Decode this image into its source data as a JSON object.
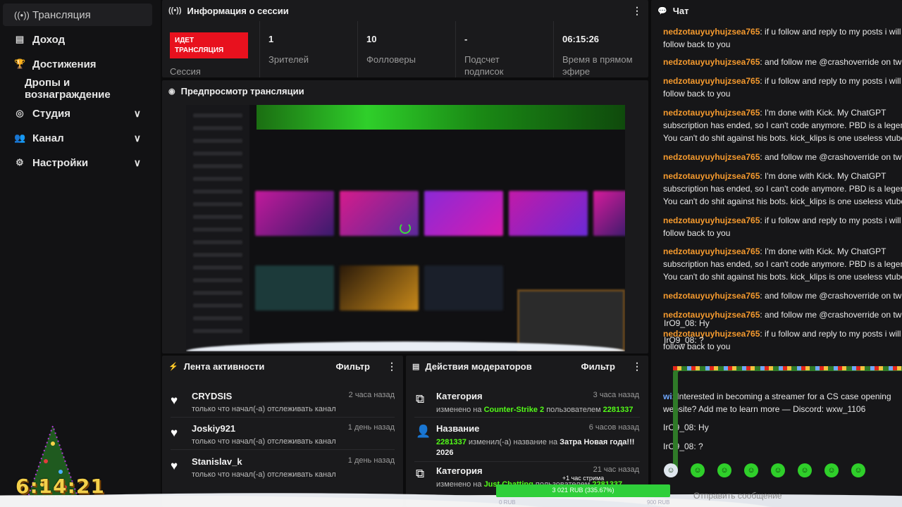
{
  "sidebar": {
    "items": [
      {
        "label": "Трансляция",
        "icon": "broadcast-icon"
      },
      {
        "label": "Доход",
        "icon": "wallet-icon"
      },
      {
        "label": "Достижения",
        "icon": "trophy-icon"
      },
      {
        "label": "Дропы и вознаграждение",
        "icon": ""
      },
      {
        "label": "Студия",
        "icon": "studio-icon"
      },
      {
        "label": "Канал",
        "icon": "users-icon"
      },
      {
        "label": "Настройки",
        "icon": "gear-icon"
      }
    ],
    "clock": "6:14:21"
  },
  "session": {
    "title": "Информация о сессии",
    "live_badge": "ИДЕТ ТРАНСЛЯЦИЯ",
    "session_label": "Сессия",
    "stats": [
      {
        "value": "1",
        "label": "Зрителей"
      },
      {
        "value": "10",
        "label": "Фолловеры"
      },
      {
        "value": "-",
        "label": "Подсчет подписок"
      },
      {
        "value": "06:15:26",
        "label": "Время в прямом эфире"
      }
    ]
  },
  "preview": {
    "title": "Предпросмотр трансляции"
  },
  "activity": {
    "title": "Лента активности",
    "filter": "Фильтр",
    "items": [
      {
        "name": "CRYDSIS",
        "time": "2 часа назад",
        "desc": "только что начал(-а) отслеживать канал"
      },
      {
        "name": "Joskiy921",
        "time": "1 день назад",
        "desc": "только что начал(-а) отслеживать канал"
      },
      {
        "name": "Stanislav_k",
        "time": "1 день назад",
        "desc": "только что начал(-а) отслеживать канал"
      }
    ]
  },
  "modlog": {
    "title": "Действия модераторов",
    "filter": "Фильтр",
    "items": [
      {
        "name": "Категория",
        "time": "3 часа назад",
        "p1": "изменено на ",
        "h1": "Counter-Strike 2",
        "p2": " пользователем ",
        "h2": "2281337",
        "p3": "",
        "h3": ""
      },
      {
        "name": "Название",
        "time": "6 часов назад",
        "p1": "",
        "h1": "2281337",
        "p2": " изменил(-а) название на ",
        "h2": "",
        "p3": "",
        "h3": "Затра Новая года!!! 2026"
      },
      {
        "name": "Категория",
        "time": "21 час назад",
        "p1": "изменено на ",
        "h1": "Just Chatting",
        "p2": " пользователем ",
        "h2": "2281337",
        "p3": "",
        "h3": ""
      }
    ]
  },
  "chat": {
    "title": "Чат",
    "messages": [
      {
        "user": "nedzotauyuyhujzsea765",
        "text": ": if u follow and reply to my posts i will follow back to you"
      },
      {
        "user": "nedzotauyuyhujzsea765",
        "text": ": and follow me @crashoverride on twitter"
      },
      {
        "user": "nedzotauyuyhujzsea765",
        "text": ": if u follow and reply to my posts i will follow back to you"
      },
      {
        "user": "nedzotauyuyhujzsea765",
        "text": ": I'm done with Kick. My ChatGPT subscription has ended, so I can't code anymore. PBD is a legend. You can't do shit against his bots. kick_klips is one useless vtuber"
      },
      {
        "user": "nedzotauyuyhujzsea765",
        "text": ": and follow me @crashoverride on twitter"
      },
      {
        "user": "nedzotauyuyhujzsea765",
        "text": ": I'm done with Kick. My ChatGPT subscription has ended, so I can't code anymore. PBD is a legend. You can't do shit against his bots. kick_klips is one useless vtuber"
      },
      {
        "user": "nedzotauyuyhujzsea765",
        "text": ": if u follow and reply to my posts i will follow back to you"
      },
      {
        "user": "nedzotauyuyhujzsea765",
        "text": ": I'm done with Kick. My ChatGPT subscription has ended, so I can't code anymore. PBD is a legend. You can't do shit against his bots. kick_klips is one useless vtuber"
      },
      {
        "user": "nedzotauyuyhujzsea765",
        "text": ": and follow me @crashoverride on twitter"
      },
      {
        "user": "nedzotauyuyhujzsea765",
        "text": ": and follow me @crashoverride on twitter"
      },
      {
        "user": "nedzotauyuyhujzsea765",
        "text": ": if u follow and reply to my posts i will follow back to you"
      },
      {
        "user": "wi",
        "text": ": Interested in becoming a streamer for a CS case opening website? Add me to learn more — Discord:  wxw_1106"
      },
      {
        "user": "IrO9_08",
        "text": ": Ну"
      },
      {
        "user": "IrO9_08",
        "text": ": ?"
      }
    ],
    "overlay": [
      {
        "text": "IrO9_08: Ну"
      },
      {
        "text": "IrO9_08: ?"
      }
    ],
    "input_placeholder": "Отправить сообщение"
  },
  "donation": {
    "title": "+1 час стрима",
    "value": "3 021 RUB (335.67%)",
    "min": "0 RUB",
    "max": "900 RUB"
  },
  "colors": {
    "accent": "#53fc18",
    "live": "#e8111e",
    "username": "#f59a2e"
  }
}
